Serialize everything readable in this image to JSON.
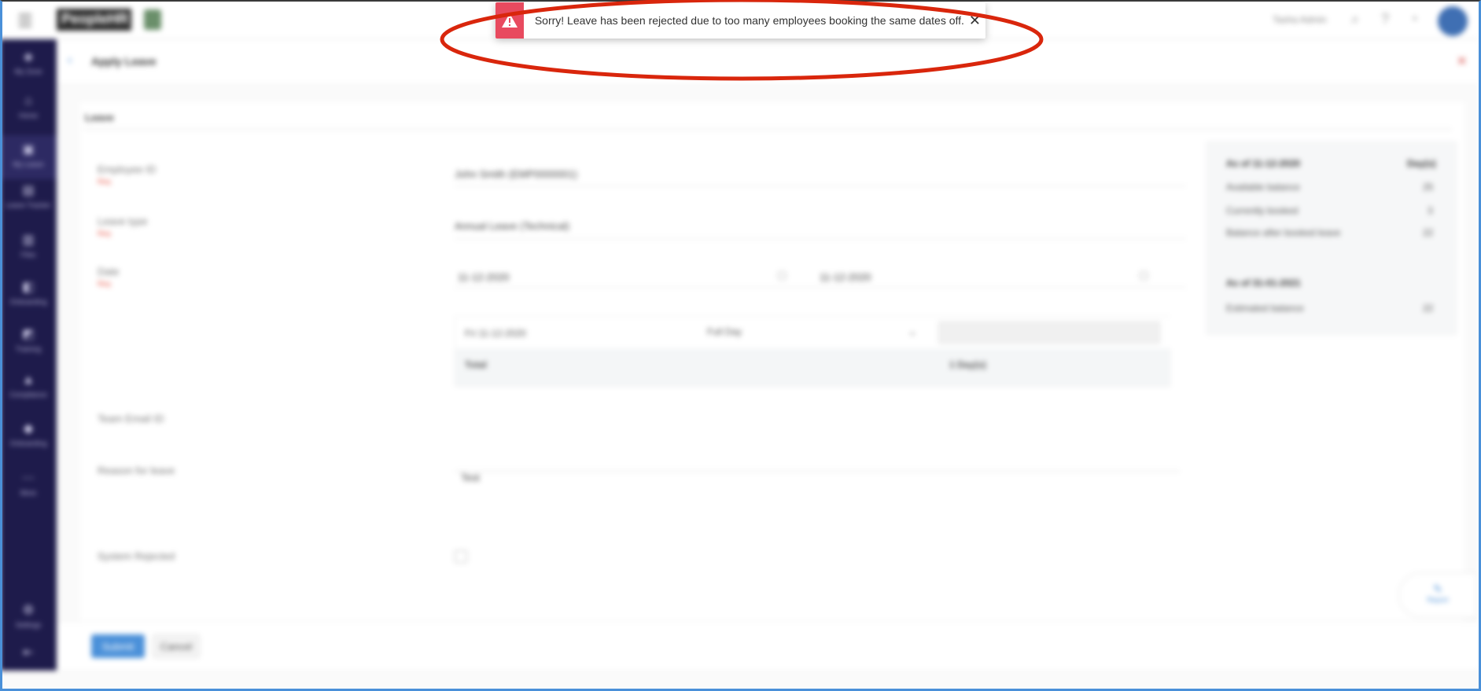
{
  "toast": {
    "message": "Sorry! Leave has been rejected due to too many employees booking the same dates off.",
    "close_symbol": "✕",
    "icon": "warning-icon",
    "color": "#e84a5f"
  },
  "annotation": {
    "color": "#d9260c"
  },
  "colors": {
    "sidebar": "#1e1b4b",
    "accent": "#4a90d9"
  },
  "topbar": {
    "right_text": "Tasha Admin"
  },
  "panel": {
    "title": "Apply Leave"
  },
  "form": {
    "section": "Leave",
    "employee_label": "Employee ID",
    "employee_value": "John Smith (EMP0000001)",
    "leave_type_label": "Leave type",
    "leave_type_value": "Annual Leave (Technical)",
    "date_label": "Date",
    "date_from": "11-12-2020",
    "date_to": "11-12-2020",
    "required": "Req",
    "row_date": "Fri 11-12-2020",
    "row_type": "Full Day",
    "col_total": "Total",
    "col_hours": "1 Day(s)",
    "team_email_label": "Team Email ID",
    "reason_label": "Reason for leave",
    "reason_value": "Test",
    "system_rejected_label": "System Rejected"
  },
  "balance": {
    "head1": "As of 11-12-2020",
    "unit": "Day(s)",
    "rows": [
      {
        "label": "Available balance",
        "value": "25"
      },
      {
        "label": "Currently booked",
        "value": "3"
      },
      {
        "label": "Balance after booked leave",
        "value": "22"
      }
    ],
    "head2": "As of 31-01-2021",
    "est_label": "Estimated balance",
    "est_value": "22"
  },
  "footer": {
    "submit": "Submit",
    "cancel": "Cancel",
    "fab": "Report"
  },
  "sidebar": {
    "items": [
      {
        "label": "My Zone"
      },
      {
        "label": "Home"
      },
      {
        "label": "My Leave"
      },
      {
        "label": "Leave Tracker"
      },
      {
        "label": "Files"
      },
      {
        "label": "Onboarding"
      },
      {
        "label": "Training"
      },
      {
        "label": "Compliance"
      },
      {
        "label": "Onboarding"
      },
      {
        "label": "More"
      }
    ],
    "settings": "Settings"
  }
}
